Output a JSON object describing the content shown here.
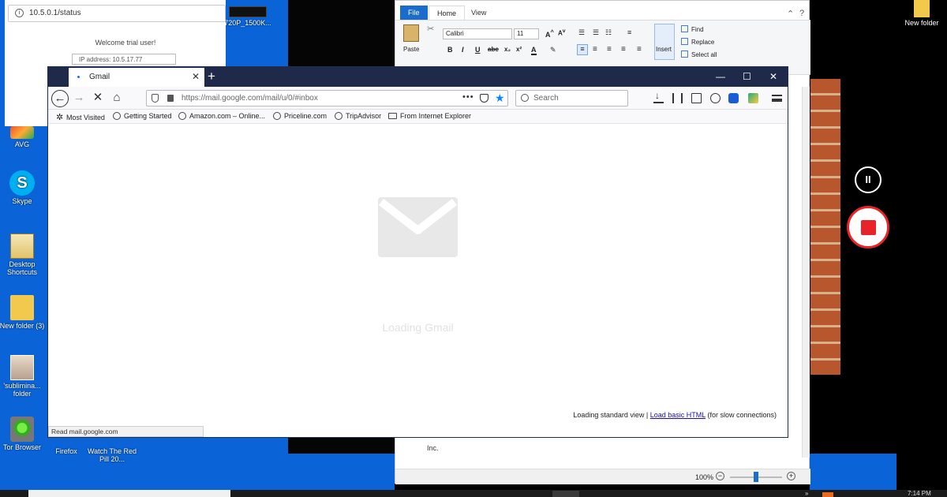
{
  "desktop": {
    "icons_left": [
      {
        "label": "AVG"
      },
      {
        "label": "Skype"
      },
      {
        "label": "Desktop Shortcuts"
      },
      {
        "label": "New folder (3)"
      },
      {
        "label": "'sublimina... folder"
      },
      {
        "label": "Tor Browser"
      }
    ],
    "icons_mid": [
      {
        "label": "Firefox"
      },
      {
        "label": "Watch The Red Pill 20..."
      }
    ],
    "icon_top_video": {
      "label": "720P_1500K..."
    },
    "icon_top_right": {
      "label": "New folder"
    }
  },
  "portal": {
    "url": "10.5.0.1/status",
    "welcome": "Welcome trial user!",
    "ip": "IP address:  10.5.17.77"
  },
  "paint": {
    "tabs": [
      "File",
      "Home",
      "View"
    ],
    "paste_label": "Paste",
    "font_name": "Calibri",
    "font_size": "11",
    "insert_label": "Insert",
    "edit_items": [
      "Find",
      "Replace",
      "Select all"
    ],
    "doc_text": "Inc.",
    "zoom": "100%"
  },
  "firefox": {
    "tab_title": "Gmail",
    "url": "https://mail.google.com/mail/u/0/#inbox",
    "search_placeholder": "Search",
    "bookmarks": [
      "Most Visited",
      "Getting Started",
      "Amazon.com – Online...",
      "Priceline.com",
      "TripAdvisor",
      "From Internet Explorer"
    ],
    "loading_text": "Loading Gmail",
    "load_note_prefix": "Loading standard view | ",
    "load_note_link": "Load basic HTML",
    "load_note_suffix": " (for slow connections)",
    "status": "Read mail.google.com"
  },
  "taskbar": {
    "clock": "7:14 PM"
  },
  "colors": {
    "desktop_blue": "#0a64d8",
    "firefox_titlebar": "#1f2a4b",
    "record_red": "#e8242a",
    "paint_accent": "#1a6dcc"
  }
}
